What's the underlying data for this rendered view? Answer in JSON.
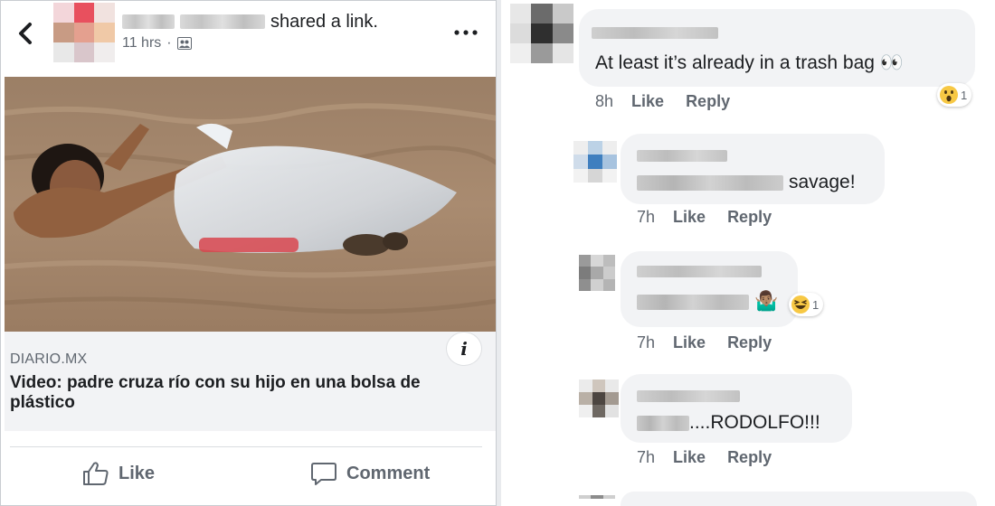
{
  "post": {
    "shared_text": "shared a link.",
    "time": "11 hrs",
    "separator": "·",
    "link": {
      "source": "DIARIO.MX",
      "title": "Video: padre cruza río con su hijo en una bolsa de plástico",
      "info_glyph": "i"
    },
    "actions": {
      "like_label": "Like",
      "comment_label": "Comment"
    }
  },
  "comments": [
    {
      "text_suffix": "At least it’s already in a trash bag 👀",
      "time": "8h",
      "like_label": "Like",
      "reply_label": "Reply",
      "reaction": {
        "icon": "wow-face-icon",
        "count": "1"
      }
    },
    {
      "text_suffix": "savage!",
      "time": "7h",
      "like_label": "Like",
      "reply_label": "Reply"
    },
    {
      "text_suffix": "🤷🏽‍♂️",
      "time": "7h",
      "like_label": "Like",
      "reply_label": "Reply",
      "reaction": {
        "icon": "haha-face-icon",
        "count": "1"
      }
    },
    {
      "text_suffix": "....RODOLFO!!!",
      "time": "7h",
      "like_label": "Like",
      "reply_label": "Reply"
    }
  ],
  "colors": {
    "text": "#1c1e21",
    "secondary_text": "#606770",
    "bubble": "#f2f3f5",
    "link_box": "#f2f3f5"
  }
}
